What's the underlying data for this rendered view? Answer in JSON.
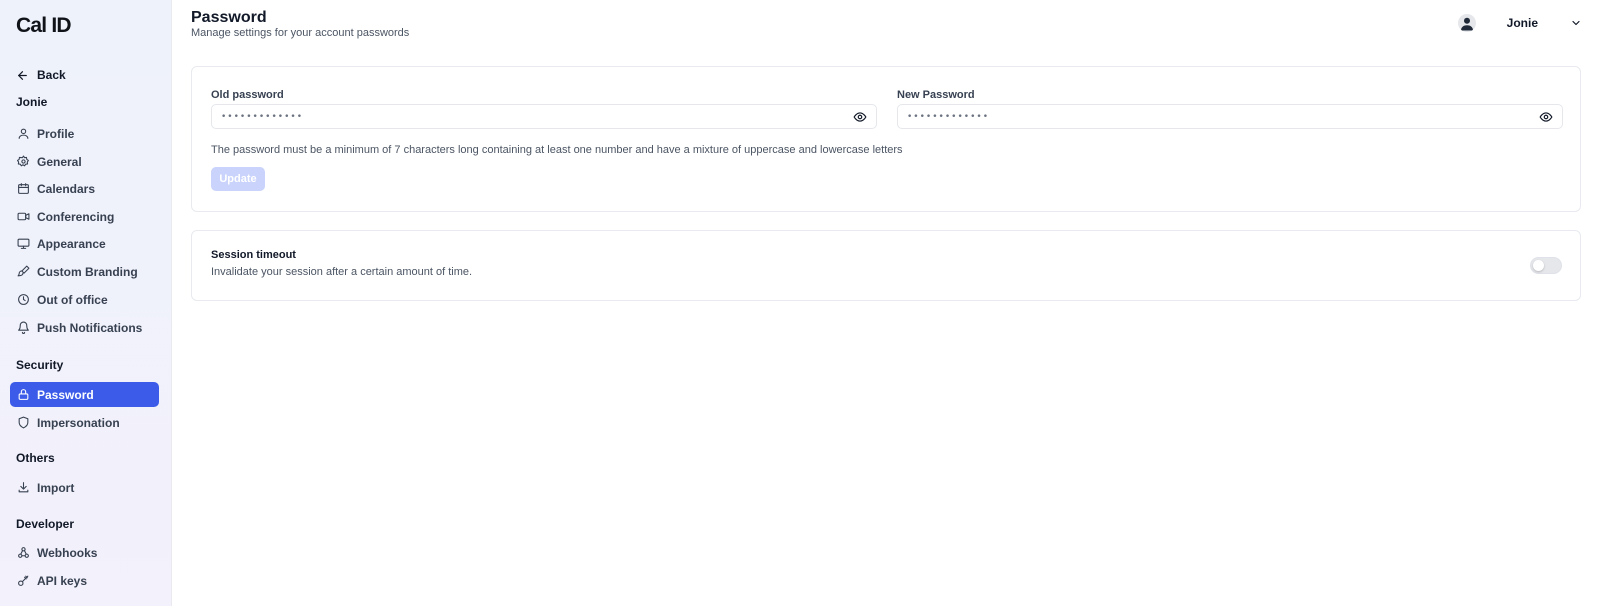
{
  "brand": {
    "logo_text": "Cal ID",
    "accent_color": "#3b5be8"
  },
  "sidebar": {
    "back_label": "Back",
    "user_group": "Jonie",
    "items": [
      {
        "label": "Profile",
        "icon": "user-icon"
      },
      {
        "label": "General",
        "icon": "gear-icon"
      },
      {
        "label": "Calendars",
        "icon": "calendar-icon"
      },
      {
        "label": "Conferencing",
        "icon": "video-icon"
      },
      {
        "label": "Appearance",
        "icon": "monitor-icon"
      },
      {
        "label": "Custom Branding",
        "icon": "brush-icon"
      },
      {
        "label": "Out of office",
        "icon": "clock-icon"
      },
      {
        "label": "Push Notifications",
        "icon": "bell-icon"
      }
    ],
    "security_group": "Security",
    "security_items": [
      {
        "label": "Password",
        "icon": "lock-icon",
        "active": true
      },
      {
        "label": "Impersonation",
        "icon": "shield-icon"
      }
    ],
    "others_group": "Others",
    "others_items": [
      {
        "label": "Import",
        "icon": "download-icon"
      }
    ],
    "developer_group": "Developer",
    "developer_items": [
      {
        "label": "Webhooks",
        "icon": "webhook-icon"
      },
      {
        "label": "API keys",
        "icon": "key-icon"
      }
    ]
  },
  "header": {
    "title": "Password",
    "subtitle": "Manage settings for your account passwords",
    "user_name": "Jonie"
  },
  "password_card": {
    "old_label": "Old password",
    "old_value": "•••••••••••••",
    "new_label": "New Password",
    "new_value": "•••••••••••••",
    "hint": "The password must be a minimum of 7 characters long containing at least one number and have a mixture of uppercase and lowercase letters",
    "update_label": "Update"
  },
  "session_card": {
    "title": "Session timeout",
    "description": "Invalidate your session after a certain amount of time.",
    "enabled": false
  }
}
